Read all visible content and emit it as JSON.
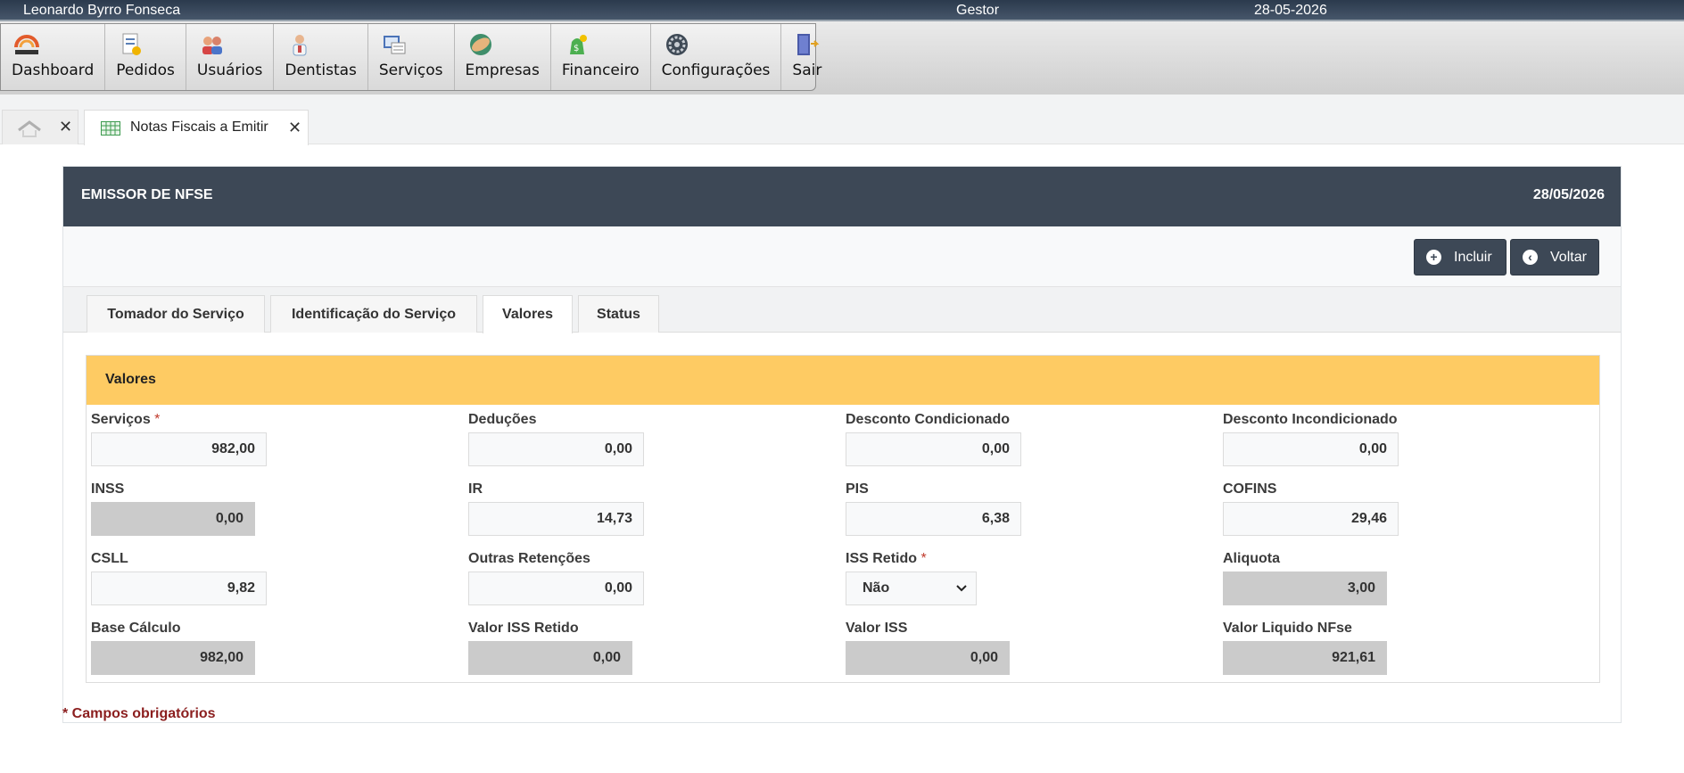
{
  "userbar": {
    "user": "Leonardo Byrro Fonseca",
    "role": "Gestor",
    "date": "28-05-2026"
  },
  "menu": [
    {
      "label": "Dashboard",
      "icon": "diagnosis-logo-icon"
    },
    {
      "label": "Pedidos",
      "icon": "orders-icon"
    },
    {
      "label": "Usuários",
      "icon": "users-icon"
    },
    {
      "label": "Dentistas",
      "icon": "dentist-icon"
    },
    {
      "label": "Serviços",
      "icon": "services-icon"
    },
    {
      "label": "Empresas",
      "icon": "handshake-icon"
    },
    {
      "label": "Financeiro",
      "icon": "money-icon"
    },
    {
      "label": "Configurações",
      "icon": "settings-icon"
    },
    {
      "label": "Sair",
      "icon": "exit-door-icon"
    }
  ],
  "tabs": {
    "close": "✕",
    "active_title": "Notas Fiscais a Emitir"
  },
  "panel": {
    "title": "EMISSOR DE NFSE",
    "date": "28/05/2026"
  },
  "toolbar": {
    "include_label": "Incluir",
    "back_label": "Voltar"
  },
  "form_tabs": [
    "Tomador do Serviço",
    "Identificação do Serviço",
    "Valores",
    "Status"
  ],
  "section": {
    "title": "Valores"
  },
  "fields": {
    "servicos": {
      "label": "Serviços",
      "value": "982,00"
    },
    "deducoes": {
      "label": "Deduções",
      "value": "0,00"
    },
    "desc_cond": {
      "label": "Desconto Condicionado",
      "value": "0,00"
    },
    "desc_incond": {
      "label": "Desconto Incondicionado",
      "value": "0,00"
    },
    "inss": {
      "label": "INSS",
      "value": "0,00"
    },
    "ir": {
      "label": "IR",
      "value": "14,73"
    },
    "pis": {
      "label": "PIS",
      "value": "6,38"
    },
    "cofins": {
      "label": "COFINS",
      "value": "29,46"
    },
    "csll": {
      "label": "CSLL",
      "value": "9,82"
    },
    "outras": {
      "label": "Outras Retenções",
      "value": "0,00"
    },
    "iss_retido": {
      "label": "ISS Retido",
      "value": "Não"
    },
    "aliquota": {
      "label": "Aliquota",
      "value": "3,00"
    },
    "base_calculo": {
      "label": "Base Cálculo",
      "value": "982,00"
    },
    "valor_iss_retido": {
      "label": "Valor ISS Retido",
      "value": "0,00"
    },
    "valor_iss": {
      "label": "Valor ISS",
      "value": "0,00"
    },
    "valor_liquido": {
      "label": "Valor Liquido NFse",
      "value": "921,61"
    }
  },
  "required_mark": "*",
  "footnote": "* Campos obrigatórios",
  "colors": {
    "header": "#3d4856",
    "section": "#fecb63",
    "required": "#c0392b"
  }
}
